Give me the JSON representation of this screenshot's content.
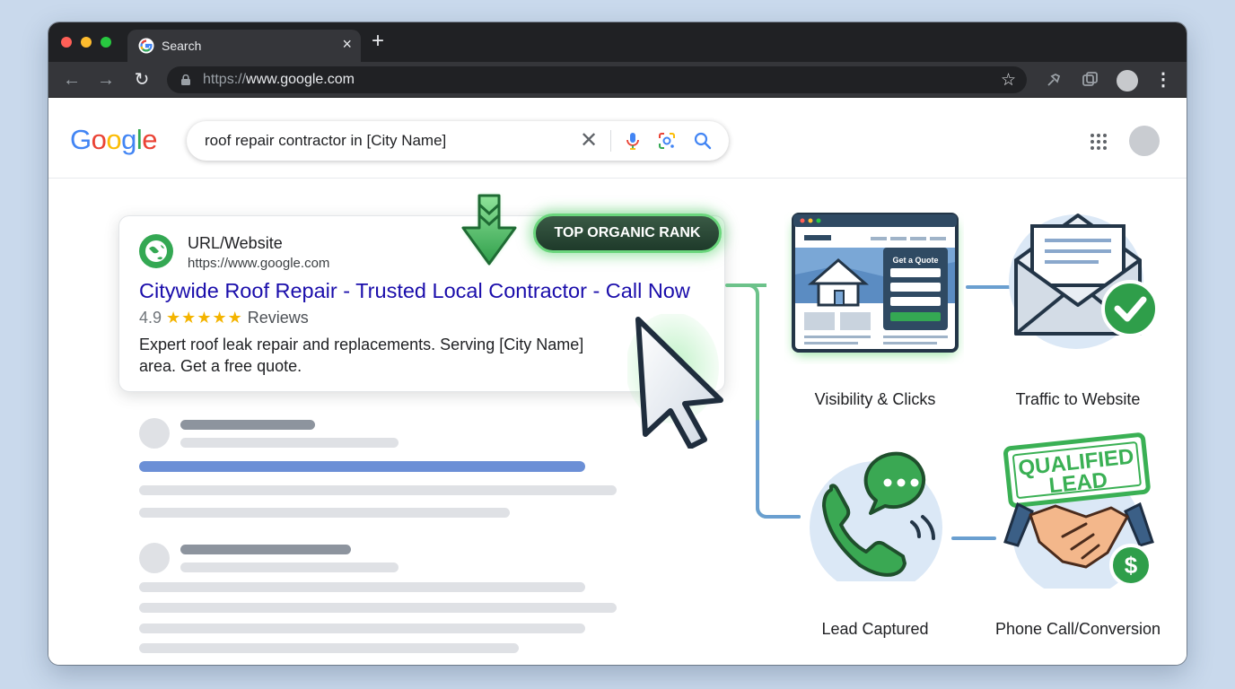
{
  "browser": {
    "tab_title": "Search",
    "tab_close": "×",
    "new_tab": "+",
    "url_scheme": "https://",
    "url_host": "www.google.com",
    "menu_glyph": "⋮",
    "star_glyph": "☆",
    "back_glyph": "←",
    "forward_glyph": "→",
    "reload_glyph": "↻"
  },
  "search": {
    "logo_letters": [
      "G",
      "o",
      "o",
      "g",
      "l",
      "e"
    ],
    "logo_colors": [
      "#4285f4",
      "#ea4335",
      "#fbbc05",
      "#4285f4",
      "#34a853",
      "#ea4335"
    ],
    "query": "roof repair contractor in [City Name]",
    "clear_glyph": "✕"
  },
  "result": {
    "site_name": "URL/Website",
    "site_url": "https://www.google.com",
    "title": "Citywide Roof Repair - Trusted Local Contractor - Call Now",
    "rating": "4.9",
    "stars": "★★★★★",
    "reviews_label": "Reviews",
    "snippet": "Expert roof leak repair and replacements. Serving [City Name] area. Get a free quote.",
    "badge": "TOP ORGANIC RANK"
  },
  "flow": {
    "steps": [
      {
        "label": "Visibility & Clicks",
        "icon": "website-quote-form-icon"
      },
      {
        "label": "Traffic to Website",
        "icon": "envelope-check-icon"
      },
      {
        "label": "Lead Captured",
        "icon": "phone-chat-icon"
      },
      {
        "label": "Phone Call/Conversion",
        "icon": "handshake-dollar-icon"
      }
    ],
    "form_button_text": "Get a Quote",
    "stamp_line1": "QUALIFIED",
    "stamp_line2": "LEAD",
    "dollar_glyph": "$",
    "accent_green": "#34a853",
    "connector_green": "#6cc28a",
    "connector_blue": "#6a9fd0"
  }
}
